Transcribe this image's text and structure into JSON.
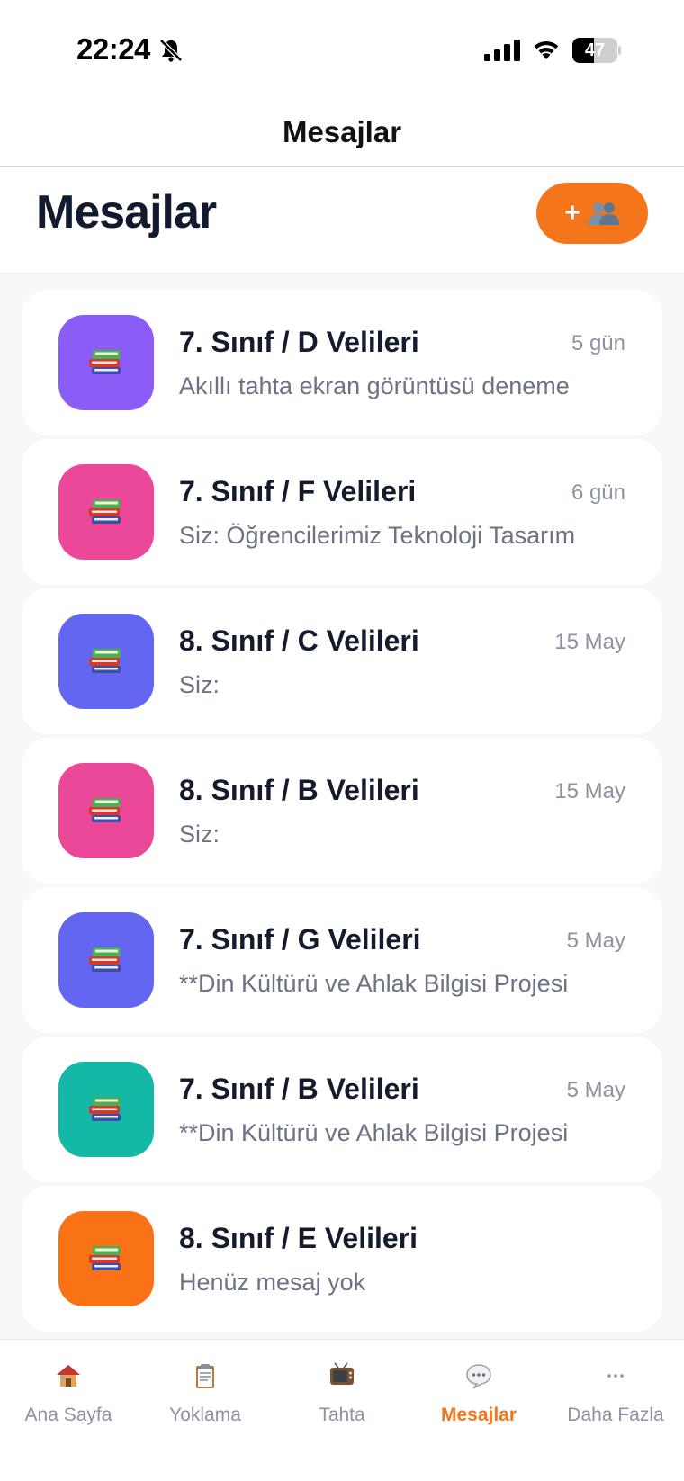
{
  "status_bar": {
    "time": "22:24",
    "battery": "47",
    "battery_fraction": 0.47
  },
  "nav": {
    "title": "Mesajlar"
  },
  "header": {
    "title": "Mesajlar",
    "new_button_plus": "+",
    "new_button_icon": "people-icon"
  },
  "colors": {
    "accent": "#f5761a",
    "title": "#141b2d",
    "muted": "#6b7384"
  },
  "conversations": [
    {
      "name": "7. Sınıf / D Velileri",
      "date": "5 gün",
      "preview": "Akıllı tahta ekran görüntüsü deneme",
      "color": "#8b5cf6",
      "icon": "books-icon"
    },
    {
      "name": "7. Sınıf / F Velileri",
      "date": "6 gün",
      "preview": "Siz: Öğrencilerimiz Teknoloji Tasarım",
      "color": "#ec4899",
      "icon": "books-icon"
    },
    {
      "name": "8. Sınıf / C Velileri",
      "date": "15 May",
      "preview": "Siz:",
      "color": "#6366f1",
      "icon": "books-icon"
    },
    {
      "name": "8. Sınıf / B Velileri",
      "date": "15 May",
      "preview": "Siz:",
      "color": "#ec4899",
      "icon": "books-icon"
    },
    {
      "name": "7. Sınıf / G Velileri",
      "date": "5 May",
      "preview": "**Din Kültürü ve Ahlak Bilgisi Projesi",
      "color": "#6366f1",
      "icon": "books-icon"
    },
    {
      "name": "7. Sınıf / B Velileri",
      "date": "5 May",
      "preview": "**Din Kültürü ve Ahlak Bilgisi Projesi",
      "color": "#14b8a6",
      "icon": "books-icon"
    },
    {
      "name": "8. Sınıf / E Velileri",
      "date": "",
      "preview": "Henüz mesaj yok",
      "color": "#f97316",
      "icon": "books-icon"
    }
  ],
  "tabs": [
    {
      "label": "Ana Sayfa",
      "icon": "house-icon",
      "active": false
    },
    {
      "label": "Yoklama",
      "icon": "clipboard-icon",
      "active": false
    },
    {
      "label": "Tahta",
      "icon": "tv-icon",
      "active": false
    },
    {
      "label": "Mesajlar",
      "icon": "speech-bubble-icon",
      "active": true
    },
    {
      "label": "Daha Fazla",
      "icon": "ellipsis-icon",
      "active": false
    }
  ]
}
